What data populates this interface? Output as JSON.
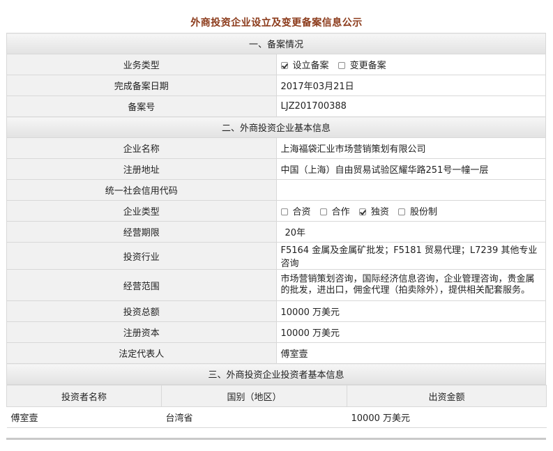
{
  "page_title": "外商投资企业设立及变更备案信息公示",
  "section1": {
    "title": "一、备案情况",
    "business_type": {
      "label": "业务类型",
      "options": [
        {
          "text": "设立备案",
          "checked": true
        },
        {
          "text": "变更备案",
          "checked": false
        }
      ]
    },
    "completion_date": {
      "label": "完成备案日期",
      "value": "2017年03月21日"
    },
    "record_no": {
      "label": "备案号",
      "value": "LJZ201700388"
    }
  },
  "section2": {
    "title": "二、外商投资企业基本信息",
    "company_name": {
      "label": "企业名称",
      "value": "上海福袋汇业市场营销策划有限公司"
    },
    "address": {
      "label": "注册地址",
      "value": "中国（上海）自由贸易试验区耀华路251号一幢一层"
    },
    "credit_code": {
      "label": "统一社会信用代码",
      "value": ""
    },
    "company_type": {
      "label": "企业类型",
      "options": [
        {
          "text": "合资",
          "checked": false
        },
        {
          "text": "合作",
          "checked": false
        },
        {
          "text": "独资",
          "checked": true
        },
        {
          "text": "股份制",
          "checked": false
        }
      ]
    },
    "term": {
      "label": "经营期限",
      "value": "20年"
    },
    "industry": {
      "label": "投资行业",
      "value": "F5164 金属及金属矿批发；F5181 贸易代理；L7239 其他专业咨询"
    },
    "scope": {
      "label": "经营范围",
      "value": "市场营销策划咨询，国际经济信息咨询，企业管理咨询，贵金属的批发，进出口，佣金代理（拍卖除外），提供相关配套服务。"
    },
    "total_investment": {
      "label": "投资总额",
      "value": "10000 万美元"
    },
    "registered_capital": {
      "label": "注册资本",
      "value": "10000 万美元"
    },
    "legal_rep": {
      "label": "法定代表人",
      "value": "傅室壹"
    }
  },
  "section3": {
    "title": "三、外商投资企业投资者基本信息",
    "headers": [
      "投资者名称",
      "国别（地区）",
      "出资金额"
    ],
    "rows": [
      [
        "傅室壹",
        "台湾省",
        "10000 万美元"
      ]
    ]
  }
}
